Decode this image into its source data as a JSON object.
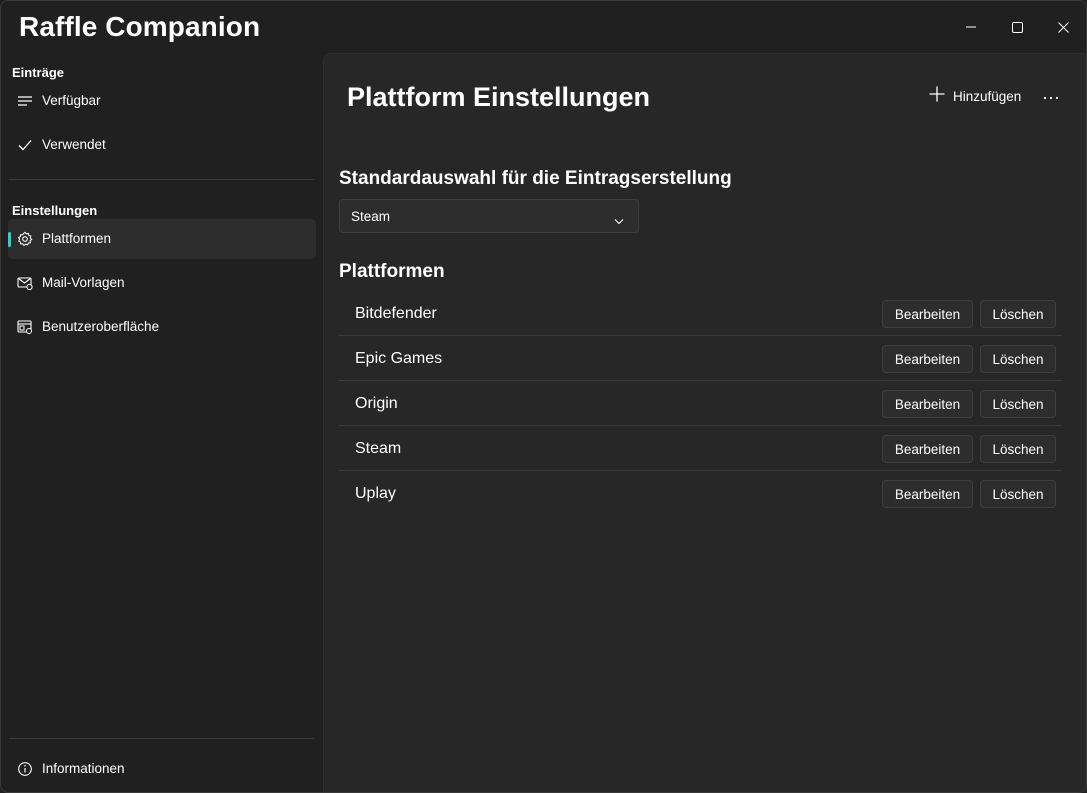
{
  "app": {
    "title": "Raffle Companion"
  },
  "window_controls": {
    "minimize_icon": "minimize-icon",
    "maximize_icon": "maximize-icon",
    "close_icon": "close-icon"
  },
  "sidebar": {
    "group1_header": "Einträge",
    "group1_items": [
      {
        "label": "Verfügbar",
        "icon": "list-icon"
      },
      {
        "label": "Verwendet",
        "icon": "checkmark-icon"
      }
    ],
    "group2_header": "Einstellungen",
    "group2_items": [
      {
        "label": "Plattformen",
        "icon": "gear-icon",
        "selected": true
      },
      {
        "label": "Mail-Vorlagen",
        "icon": "mail-settings-icon"
      },
      {
        "label": "Benutzeroberfläche",
        "icon": "ui-settings-icon"
      }
    ],
    "footer_item": {
      "label": "Informationen",
      "icon": "info-icon"
    }
  },
  "page": {
    "title": "Plattform Einstellungen",
    "add_label": "Hinzufügen",
    "more_icon": "more-icon"
  },
  "default_selection": {
    "heading": "Standardauswahl für die Eintragserstellung",
    "selected_value": "Steam"
  },
  "platforms": {
    "heading": "Plattformen",
    "edit_label": "Bearbeiten",
    "delete_label": "Löschen",
    "items": [
      "Bitdefender",
      "Epic Games",
      "Origin",
      "Steam",
      "Uplay"
    ]
  },
  "colors": {
    "accent": "#4cc2c4",
    "window_bg": "#202020",
    "content_bg": "#272727"
  }
}
